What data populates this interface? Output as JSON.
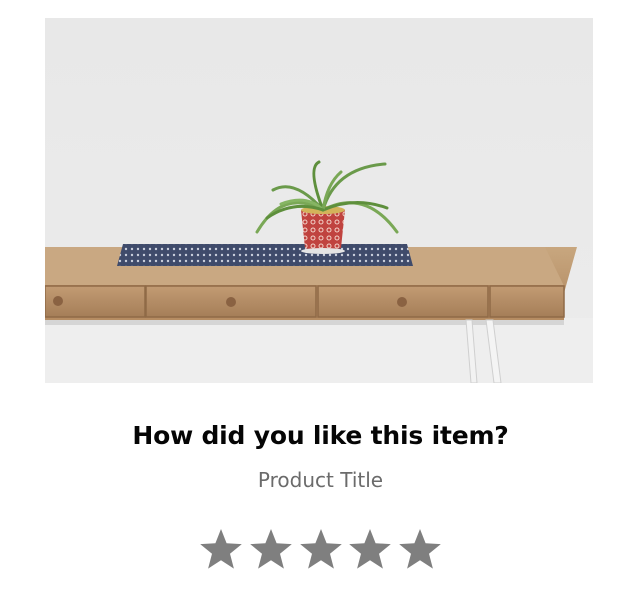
{
  "review": {
    "question": "How did you like this item?",
    "product_title": "Product Title"
  },
  "image": {
    "subject": "wooden desk with potted plant"
  },
  "rating": {
    "stars_total": 5,
    "stars_selected": 0,
    "star_color": "#7f7f7f"
  },
  "colors": {
    "question_text": "#050505",
    "product_title_text": "#6b6b6b",
    "background": "#ffffff"
  }
}
